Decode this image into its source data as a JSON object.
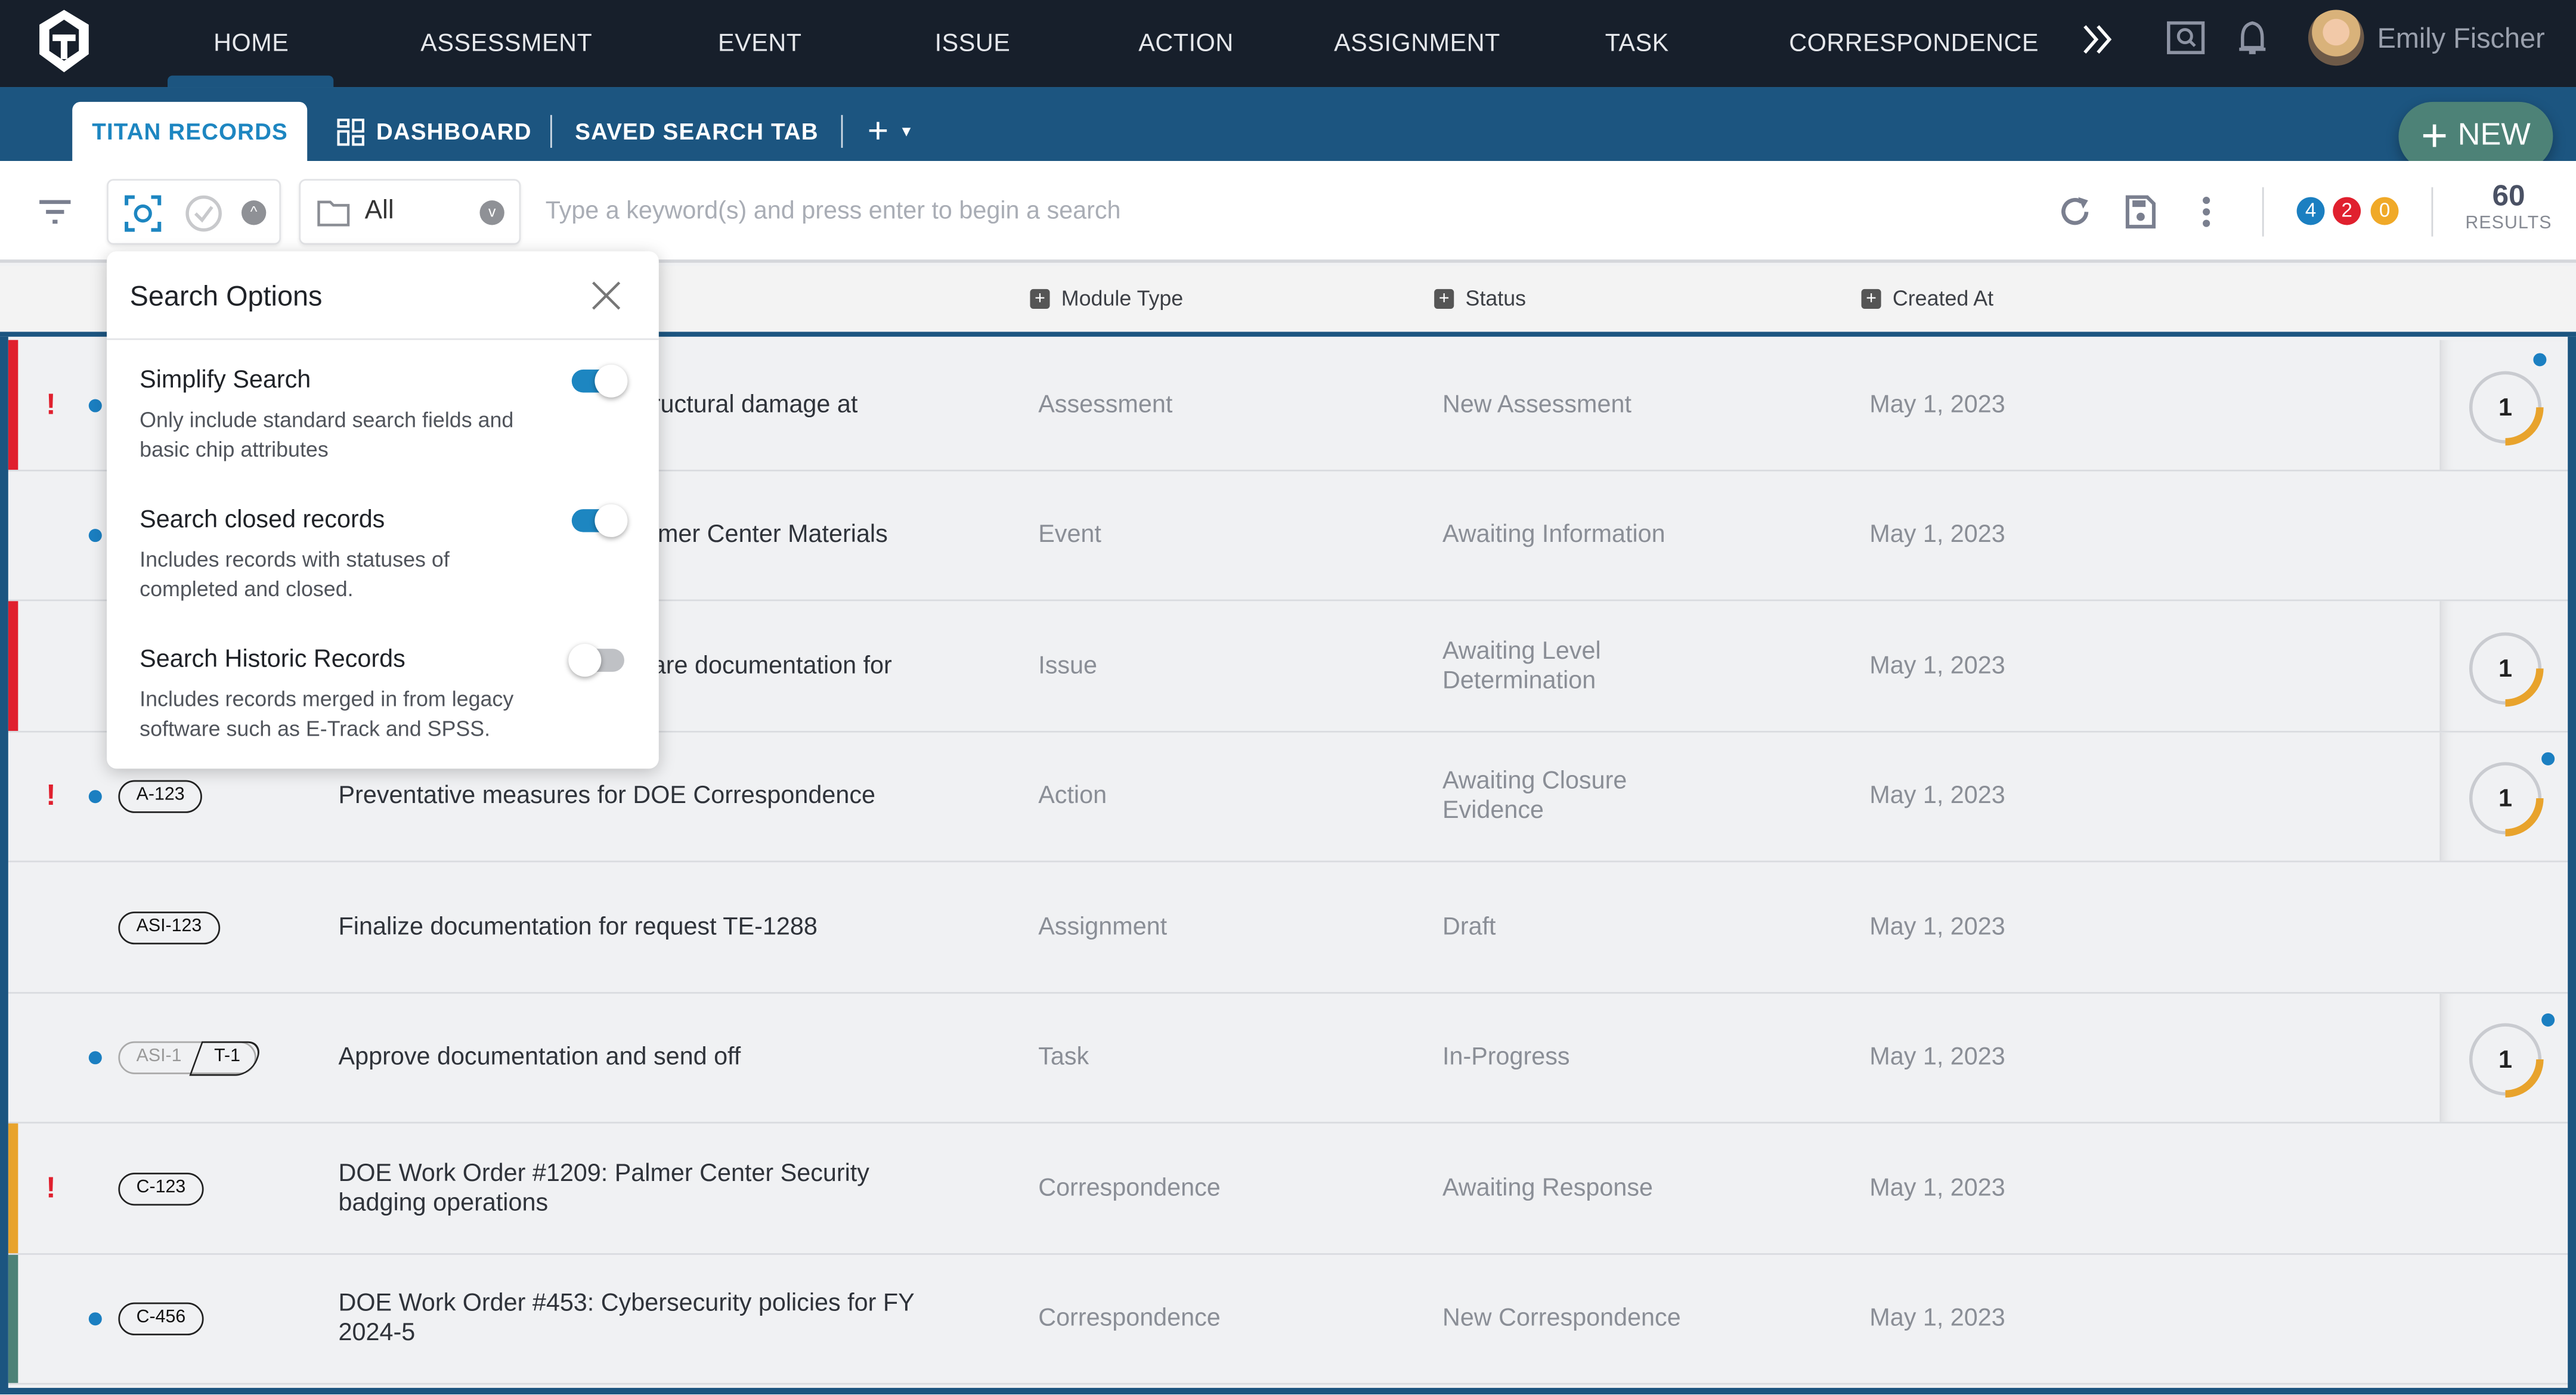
{
  "nav": {
    "items": [
      "HOME",
      "ASSESSMENT",
      "EVENT",
      "ISSUE",
      "ACTION",
      "ASSIGNMENT",
      "TASK",
      "CORRESPONDENCE"
    ],
    "active": "HOME",
    "user": "Emily Fischer"
  },
  "tabs": {
    "items": [
      "TITAN RECORDS",
      "DASHBOARD",
      "SAVED SEARCH TAB"
    ],
    "active": "TITAN RECORDS",
    "add": "+",
    "new_button": "NEW"
  },
  "toolbar": {
    "folder_select": "All",
    "search_placeholder": "Type a keyword(s) and press enter to begin a search",
    "badges": [
      "4",
      "2",
      "0"
    ],
    "badge_colors": [
      "#1b7fc1",
      "#e0202e",
      "#f0a928"
    ],
    "results_count": "60",
    "results_label": "RESULTS"
  },
  "columns": {
    "module": "Module Type",
    "status": "Status",
    "created": "Created At"
  },
  "popover": {
    "title": "Search Options",
    "options": [
      {
        "label": "Simplify Search",
        "desc": "Only include standard search fields and basic chip attributes",
        "on": true
      },
      {
        "label": "Search closed records",
        "desc": "Includes records with statuses of completed and closed.",
        "on": true
      },
      {
        "label": "Search Historic Records",
        "desc": "Includes records merged in from legacy software such as E-Track and SPSS.",
        "on": false
      }
    ]
  },
  "rows": [
    {
      "chip": "",
      "title": "ructural damage at",
      "module": "Assessment",
      "status": "New Assessment",
      "created": "May 1, 2023",
      "ring": "1",
      "flag": true,
      "dot": true,
      "bar": "#e0202e",
      "ring_dot": true
    },
    {
      "chip": "",
      "title": "lmer Center Materials",
      "module": "Event",
      "status": "Awaiting Information",
      "created": "May 1, 2023",
      "ring": "",
      "flag": false,
      "dot": true,
      "bar": ""
    },
    {
      "chip": "",
      "title": "are documentation for",
      "module": "Issue",
      "status": "Awaiting Level Determination",
      "created": "May 1, 2023",
      "ring": "1",
      "flag": false,
      "dot": false,
      "bar": "#e0202e",
      "ring_dot": false
    },
    {
      "chip": "A-123",
      "title": "Preventative measures for DOE Correspondence",
      "module": "Action",
      "status": "Awaiting Closure Evidence",
      "created": "May 1, 2023",
      "ring": "1",
      "flag": true,
      "dot": true,
      "bar": "",
      "ring_dot": true
    },
    {
      "chip": "ASI-123",
      "title": "Finalize documentation for request TE-1288",
      "module": "Assignment",
      "status": "Draft",
      "created": "May 1, 2023",
      "ring": "",
      "flag": false,
      "dot": false,
      "bar": ""
    },
    {
      "chip": "T-1",
      "chip_parent": "ASI-1",
      "title": "Approve documentation and send off",
      "module": "Task",
      "status": "In-Progress",
      "created": "May 1, 2023",
      "ring": "1",
      "flag": false,
      "dot": true,
      "bar": "",
      "ring_dot": true
    },
    {
      "chip": "C-123",
      "title": "DOE Work Order #1209: Palmer Center Security badging operations",
      "module": "Correspondence",
      "status": "Awaiting Response",
      "created": "May 1, 2023",
      "ring": "",
      "flag": true,
      "dot": false,
      "bar": "#e8a32c"
    },
    {
      "chip": "C-456",
      "title": "DOE Work Order #453: Cybersecurity policies for FY 2024-5",
      "module": "Correspondence",
      "status": "New Correspondence",
      "created": "May 1, 2023",
      "ring": "",
      "flag": false,
      "dot": true,
      "bar": "#4d8277"
    }
  ],
  "colors": {
    "nav_bg": "#171f2b",
    "brand_blue": "#1c5580",
    "accent": "#1d86c1",
    "new_button": "#4d8277",
    "ring": "#e8a32c"
  }
}
